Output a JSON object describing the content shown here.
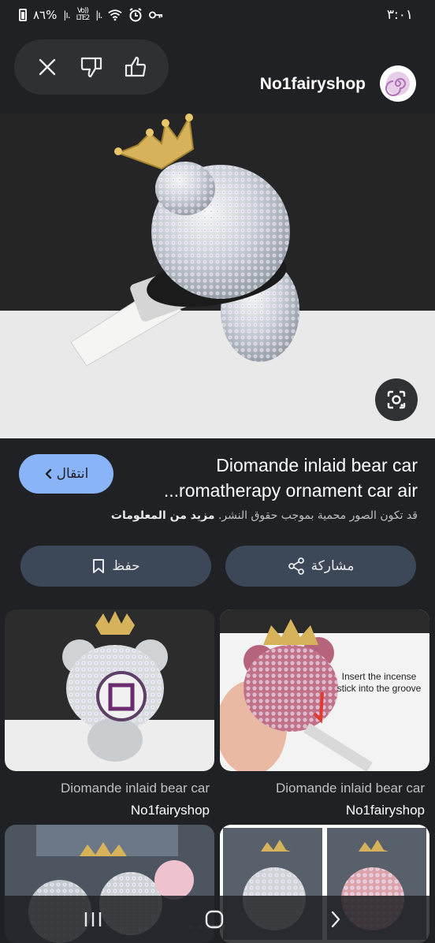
{
  "status_bar": {
    "battery_text": "٨٦%",
    "network_label": "Vo))\nLTE2",
    "time": "٣:٠١"
  },
  "top_bar": {
    "source_name": "No1fairyshop"
  },
  "result": {
    "title_line1": "Diomande inlaid bear car",
    "title_line2": "...romatherapy ornament car air",
    "visit_label": "انتقال",
    "copyright_notice": "قد تكون الصور محمية بموجب حقوق النشر.",
    "learn_more": "مزيد من المعلومات"
  },
  "actions": {
    "share_label": "مشاركة",
    "save_label": "حفظ"
  },
  "related": [
    {
      "title": "Diomande inlaid bear car",
      "source": "No1fairyshop"
    },
    {
      "title": "Diomande inlaid bear car",
      "source": "No1fairyshop",
      "overlay_text": "Insert the incense stick into the groove"
    }
  ],
  "colors": {
    "background": "#202124",
    "accent": "#8ab4f8",
    "button_bg": "#3c4858"
  }
}
